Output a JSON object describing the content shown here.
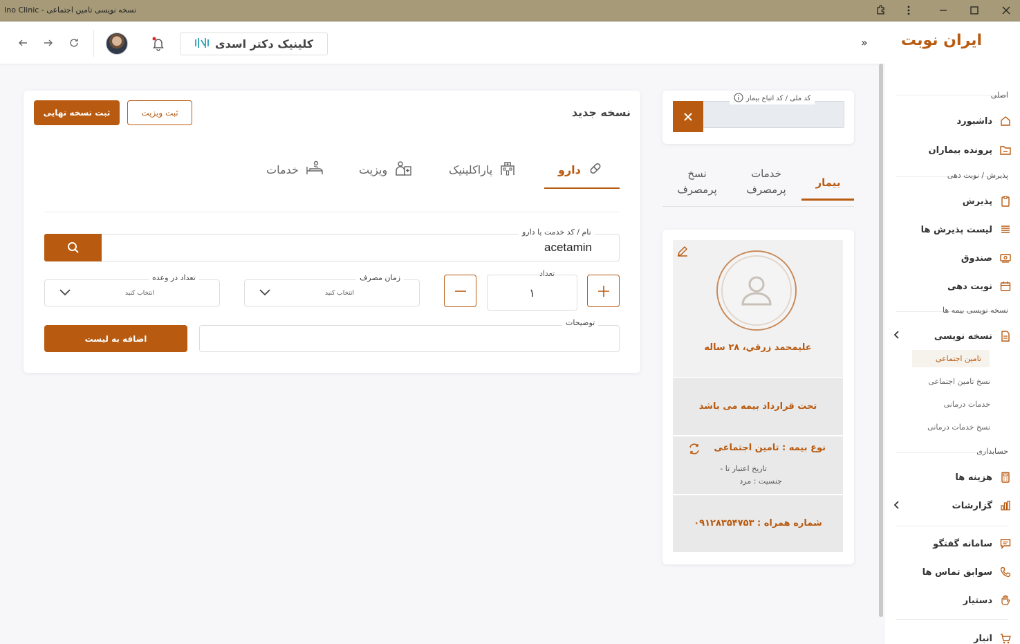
{
  "window": {
    "title": "Ino Clinic - نسخه نویسی تامین اجتماعی"
  },
  "header": {
    "logo": "ایران نوبت",
    "clinic_name": "کلینیک دکتر اسدی"
  },
  "sidebar": {
    "section_main": "اصلی",
    "item_dashboard": "داشبورد",
    "item_patients": "پرونده بیماران",
    "section_reception": "پذیرش / نوبت دهی",
    "item_reception": "پذیرش",
    "item_reception_list": "لیست پذیرش ها",
    "item_cashbox": "صندوق",
    "item_appointment": "نوبت دهی",
    "section_prescription": "نسخه نویسی بیمه ها",
    "item_prescription": "نسخه نویسی",
    "sub_social_security": "تامین اجتماعی",
    "sub_social_security_rx": "نسخ تامین اجتماعی",
    "sub_medical_services": "خدمات درمانی",
    "sub_medical_services_rx": "نسخ خدمات درمانی",
    "section_accounting": "حسابداری",
    "item_costs": "هزینه ها",
    "item_reports": "گزارشات",
    "item_chat": "سامانه گفتگو",
    "item_call_history": "سوابق تماس ها",
    "item_assistant": "دستیار",
    "item_warehouse": "انبار"
  },
  "patient_search": {
    "label": "کد ملی / کد اتباع بیمار",
    "value": ""
  },
  "patient_tabs": {
    "patient": "بیمار",
    "frequent_services": "خدمات پرمصرف",
    "frequent_prescriptions": "نسخ پرمصرف"
  },
  "patient": {
    "name_age": "علیمحمد زرقي، ۲۸ ساله",
    "contract_status": "تحت قرارداد بیمه می باشد",
    "insurance_type": "نوع بیمه : تامین اجتماعی",
    "validity_date": "تاریخ اعتبار تا -",
    "gender": "جنسیت : مرد",
    "phone": "شماره همراه : ۰۹۱۲۸۳۵۴۷۵۳"
  },
  "prescription": {
    "title": "نسخه جدید",
    "final_button": "ثبت نسخه نهایی",
    "visit_button": "ثبت ویزیت",
    "tabs": {
      "drug": "دارو",
      "paraclinic": "پاراکلینیک",
      "visit": "ویزیت",
      "services": "خدمات"
    },
    "active_tab": "drug",
    "search_label": "نام / کد خدمت یا دارو",
    "search_value": "acetamin",
    "quantity_label": "تعداد",
    "quantity_value": "۱",
    "usage_time_label": "زمان مصرف",
    "usage_time_value": "انتخاب کنید",
    "per_dose_label": "تعداد در وعده",
    "per_dose_value": "انتخاب کنید",
    "description_label": "توضیحات",
    "description_value": "",
    "add_button": "اضافه به لیست"
  },
  "colors": {
    "accent": "#b85a10",
    "titlebar": "#a69a78"
  }
}
